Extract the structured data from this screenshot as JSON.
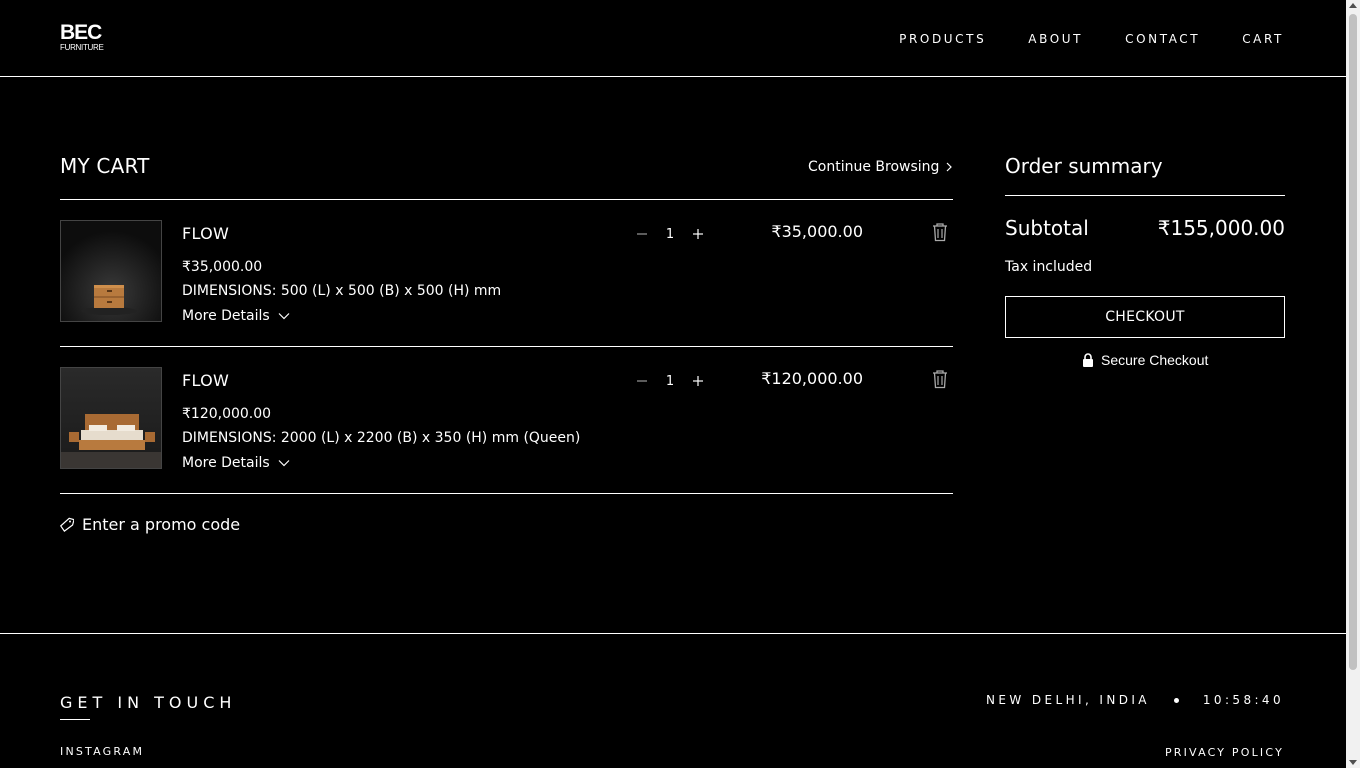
{
  "header": {
    "logo_main": "BEC",
    "logo_sub": "FURNITURE",
    "nav": [
      "PRODUCTS",
      "ABOUT",
      "CONTACT",
      "CART"
    ]
  },
  "cart": {
    "title": "MY CART",
    "continue_label": "Continue Browsing",
    "items": [
      {
        "name": "FLOW",
        "unit_price": "₹35,000.00",
        "dimensions": "DIMENSIONS: 500 (L) x 500 (B) x 500 (H) mm",
        "more_label": "More Details",
        "quantity": "1",
        "line_price": "₹35,000.00"
      },
      {
        "name": "FLOW",
        "unit_price": "₹120,000.00",
        "dimensions": "DIMENSIONS: 2000 (L) x 2200 (B) x 350 (H) mm (Queen)",
        "more_label": "More Details",
        "quantity": "1",
        "line_price": "₹120,000.00"
      }
    ],
    "promo_label": "Enter a promo code"
  },
  "summary": {
    "title": "Order summary",
    "subtotal_label": "Subtotal",
    "subtotal_value": "₹155,000.00",
    "tax_note": "Tax included",
    "checkout_label": "CHECKOUT",
    "secure_label": "Secure Checkout"
  },
  "footer": {
    "heading": "GET IN TOUCH",
    "instagram": "INSTAGRAM",
    "location": "NEW DELHI, INDIA",
    "time": "10:58:40",
    "privacy": "PRIVACY POLICY"
  },
  "colors": {
    "background": "#000000",
    "text": "#ffffff",
    "accent_wood": "#b87a3e"
  },
  "icons": [
    "chevron-right-icon",
    "chevron-down-icon",
    "minus-icon",
    "plus-icon",
    "trash-icon",
    "tag-icon",
    "lock-icon"
  ]
}
